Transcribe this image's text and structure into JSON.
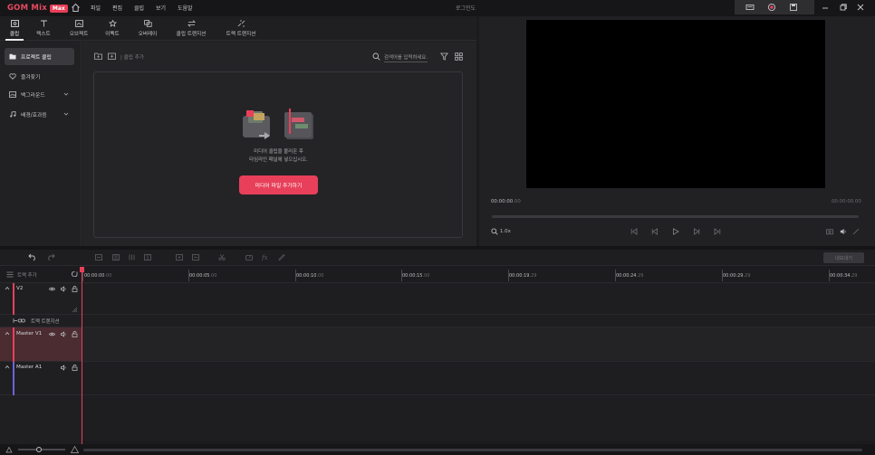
{
  "app": {
    "logo_text": "GOM Mix",
    "logo_badge": "Max",
    "login_label": "로그인도"
  },
  "menu": [
    "파일",
    "편집",
    "클립",
    "보기",
    "도움말"
  ],
  "tabs": [
    {
      "label": "클립",
      "icon": "clip-icon"
    },
    {
      "label": "텍스트",
      "icon": "text-icon"
    },
    {
      "label": "오브젝트",
      "icon": "object-icon"
    },
    {
      "label": "이펙트",
      "icon": "effect-icon"
    },
    {
      "label": "오버레이",
      "icon": "overlay-icon"
    },
    {
      "label": "클립 트랜지션",
      "icon": "clip-transition-icon"
    },
    {
      "label": "트랙 트랜지션",
      "icon": "track-transition-icon"
    }
  ],
  "sidebar": {
    "items": [
      {
        "label": "프로젝트 클립",
        "icon": "folder-icon",
        "active": true
      },
      {
        "label": "즐겨찾기",
        "icon": "heart-icon"
      },
      {
        "label": "백그라운드",
        "icon": "image-icon",
        "expandable": true
      },
      {
        "label": "배경/효과음",
        "icon": "music-icon",
        "expandable": true
      }
    ]
  },
  "clip_toolbar": {
    "add_clip_label": "| 클립 추가",
    "search_placeholder": "검색어를 입력하세요."
  },
  "dropzone": {
    "message_line1": "미디어 클립을 불러온 후",
    "message_line2": "타임라인 패널에 넣으십시오.",
    "button_label": "미디어 파일 추가하기"
  },
  "preview": {
    "timecode_left_main": "00:00:00",
    "timecode_left_frames": ".00",
    "timecode_right": "00:00:00.00",
    "zoom_label": "1.0x"
  },
  "timeline": {
    "export_label": "내보내기",
    "track_add_label": "트랙 추가",
    "ruler_ticks": [
      {
        "main": "00:00:00",
        "frames": ".00"
      },
      {
        "main": "00:00:05",
        "frames": ".00"
      },
      {
        "main": "00:00:10",
        "frames": ".00"
      },
      {
        "main": "00:00:15",
        "frames": ".00"
      },
      {
        "main": "00:00:19",
        "frames": ".29"
      },
      {
        "main": "00:00:24",
        "frames": ".29"
      },
      {
        "main": "00:00:29",
        "frames": ".29"
      },
      {
        "main": "00:00:34",
        "frames": ".29"
      }
    ],
    "tracks": {
      "v2": "V2",
      "track_transition": "트랙 트랜지션",
      "master_v1": "Master V1",
      "master_a1": "Master A1"
    }
  },
  "colors": {
    "accent": "#e8405a",
    "track_video": "#e8405a",
    "track_audio": "#6c63d9"
  }
}
